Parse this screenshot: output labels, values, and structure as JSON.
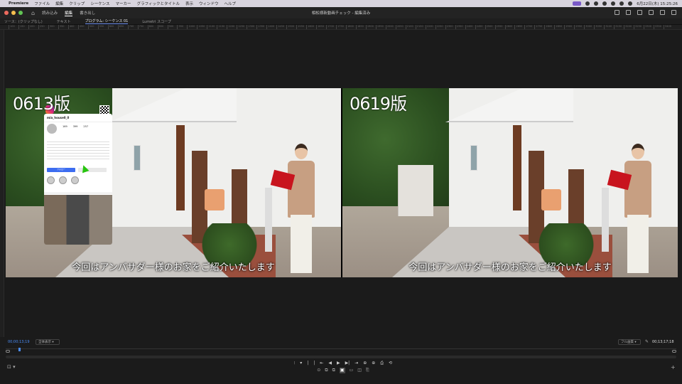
{
  "menubar": {
    "app": "Premiere",
    "items": [
      "ファイル",
      "編集",
      "クリップ",
      "シーケンス",
      "マーカー",
      "グラフィックとタイトル",
      "表示",
      "ウィンドウ",
      "ヘルプ"
    ],
    "clock": "6月22日(木) 15:25:26"
  },
  "titlebar": {
    "tabs": [
      "読み込み",
      "編集",
      "書き出し"
    ],
    "active_tab": "編集",
    "document_title": "相松様新動画チェック - 編集済み"
  },
  "panels": {
    "tabs": [
      "ソース：(クリップなし)",
      "テキスト",
      "プログラム: シーケンス 01",
      "Lumetri スコープ"
    ],
    "active": "プログラム: シーケンス 01"
  },
  "ruler": {
    "ticks": [
      "100",
      "150",
      "200",
      "250",
      "300",
      "350",
      "400",
      "450",
      "500",
      "550",
      "600",
      "650",
      "700",
      "750",
      "800",
      "850",
      "900",
      "950",
      "1000",
      "1050",
      "1100",
      "1150",
      "1200",
      "1250",
      "1300",
      "1350",
      "1400",
      "1450",
      "1500",
      "1550",
      "1600",
      "1650",
      "1700",
      "1750",
      "1800",
      "1850",
      "1900",
      "1950",
      "2000",
      "2050",
      "2100",
      "2150",
      "2200",
      "2250",
      "2300",
      "2350",
      "2400",
      "2450",
      "2500",
      "2550",
      "2600",
      "2650",
      "2700",
      "2750",
      "2800",
      "2850",
      "2900",
      "2950",
      "3000",
      "3050",
      "3100",
      "3150",
      "3200",
      "3250",
      "3300",
      "3350",
      "3400"
    ]
  },
  "viewer": {
    "left": {
      "version_label": "0613版",
      "subtitle": "今回はアンバサダー様のお家をご紹介いたします",
      "overlay": {
        "handle": "mia_house0_0",
        "stats": [
          "169",
          "399",
          "257"
        ],
        "follow_label": "フォロー"
      }
    },
    "right": {
      "version_label": "0619版",
      "subtitle": "今回はアンバサダー様のお家をご紹介いたします"
    }
  },
  "controls": {
    "timecode_current": "00;00;13;19",
    "fit_label": "全体表示",
    "quality_label": "フル画質",
    "timecode_duration": "00;13;17;18",
    "transport_row1": [
      "⦙",
      "▾",
      "|",
      "|",
      "⇤",
      "◀",
      "▶",
      "▶|",
      "⇥",
      "⊕",
      "⊕",
      "⎙",
      "⟲"
    ],
    "transport_row2": [
      "⊙",
      "⧉",
      "⧉",
      "▣",
      "▭",
      "◫",
      "⎘"
    ]
  },
  "colors": {
    "accent": "#4b8cf5",
    "bg": "#1b1b1b",
    "highlight_menu": "#7a59c8"
  }
}
